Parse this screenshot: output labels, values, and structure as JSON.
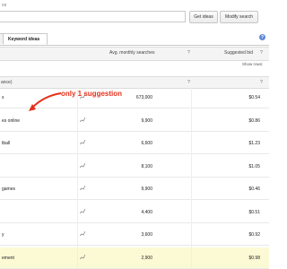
{
  "search": {
    "label": "ce",
    "query": "",
    "get_ideas_label": "Get ideas",
    "modify_search_label": "Modify search"
  },
  "tabs": {
    "prev": "",
    "keyword_ideas": "Keyword ideas"
  },
  "columns": {
    "avg": "Avg. monthly searches",
    "bid": "Suggested bid",
    "keyword": "ance)"
  },
  "show_rows": "Show rows:",
  "annotation": {
    "text": "only 1 suggestion",
    "color": "#e3311b"
  },
  "rows": [
    {
      "keyword": "s",
      "avg": "673,000",
      "bid": "$0.54",
      "highlight": false
    },
    {
      "keyword": "es online",
      "avg": "9,900",
      "bid": "$0.86",
      "highlight": false
    },
    {
      "keyword": "tball",
      "avg": "6,600",
      "bid": "$1.23",
      "highlight": false
    },
    {
      "keyword": "",
      "avg": "8,100",
      "bid": "$1.05",
      "highlight": false
    },
    {
      "keyword": "games",
      "avg": "9,900",
      "bid": "$0.46",
      "highlight": false
    },
    {
      "keyword": "",
      "avg": "4,400",
      "bid": "$0.51",
      "highlight": false
    },
    {
      "keyword": "y",
      "avg": "3,600",
      "bid": "$0.92",
      "highlight": false
    },
    {
      "keyword": "ement",
      "avg": "2,900",
      "bid": "$0.98",
      "highlight": true
    }
  ]
}
